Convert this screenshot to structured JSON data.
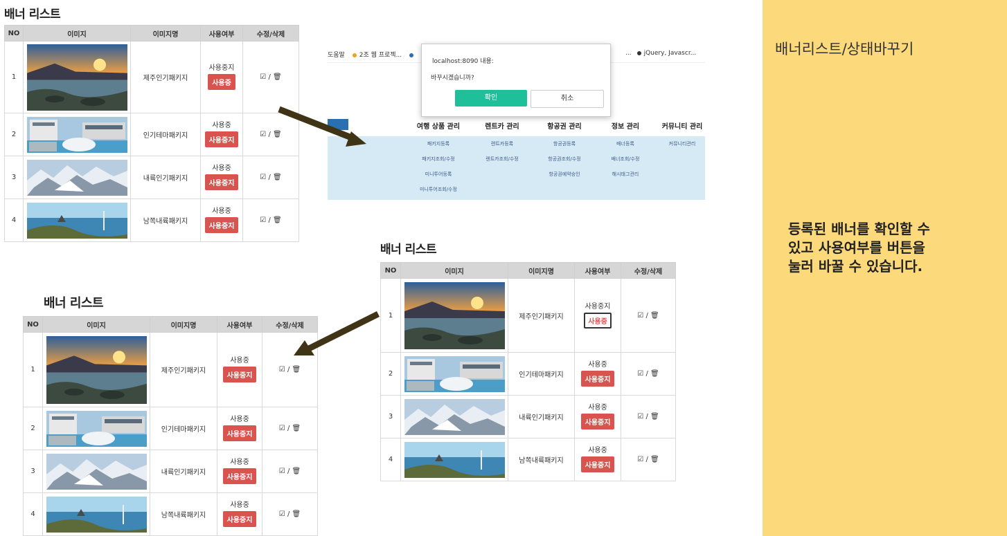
{
  "banner_table": {
    "title": "배너 리스트",
    "columns": [
      "NO",
      "이미지",
      "이미지명",
      "사용여부",
      "수정/삭제"
    ],
    "rows": [
      {
        "no": "1",
        "name": "제주인기패키지",
        "status_text": "사용중지",
        "button": "사용중"
      },
      {
        "no": "2",
        "name": "인기테마패키지",
        "status_text": "사용중",
        "button": "사용중지"
      },
      {
        "no": "3",
        "name": "내륙인기패키지",
        "status_text": "사용중",
        "button": "사용중지"
      },
      {
        "no": "4",
        "name": "남쪽내륙패키지",
        "status_text": "사용중",
        "button": "사용중지"
      }
    ],
    "edit_delete": "✎ / 🗑"
  },
  "banner_table_after": {
    "title": "배너 리스트",
    "rows": [
      {
        "no": "1",
        "name": "제주인기패키지",
        "status_text": "사용중",
        "button": "사용중지"
      },
      {
        "no": "2",
        "name": "인기테마패키지",
        "status_text": "사용중",
        "button": "사용중지"
      },
      {
        "no": "3",
        "name": "내륙인기패키지",
        "status_text": "사용중",
        "button": "사용중지"
      },
      {
        "no": "4",
        "name": "남쪽내륙패키지",
        "status_text": "사용중",
        "button": "사용중지"
      }
    ]
  },
  "browser": {
    "bookmarks": [
      "도움말",
      "2조 웹 프로젝...",
      "...",
      "jQuery, Javascr..."
    ],
    "bookmark_colors": [
      "#f0a020",
      "#2a6fb0",
      "#333333"
    ],
    "dialog": {
      "host": "localhost:8090 내용:",
      "message": "바꾸시겠습니까?",
      "ok": "확인",
      "cancel": "취소"
    },
    "menu_headers": [
      "여행 상품 관리",
      "렌트카 관리",
      "항공권 관리",
      "정보 관리",
      "커뮤니티 관리"
    ],
    "menu_columns": [
      [
        "패키지등록",
        "패키지조회/수정",
        "미니투어등록",
        "미니투어조회/수정"
      ],
      [
        "렌트카등록",
        "렌트카조회/수정"
      ],
      [
        "항공권등록",
        "항공권조회/수정",
        "항공권예약승인"
      ],
      [
        "배너등록",
        "배너조회/수정",
        "해시태그관리"
      ],
      [
        "커뮤니티관리"
      ]
    ]
  },
  "side_panel": {
    "title": "배너리스트/상태바꾸기",
    "description_lines": [
      "등록된 배너를 확인할 수",
      "있고 사용여부를 버튼을",
      "눌러 바꿀 수 있습니다."
    ]
  },
  "colors": {
    "accent_red": "#d9534f",
    "dialog_ok": "#1fbf9a",
    "side_panel": "#fcd97a",
    "menu_bg": "#d6eaf6",
    "arrow": "#3f3415"
  }
}
